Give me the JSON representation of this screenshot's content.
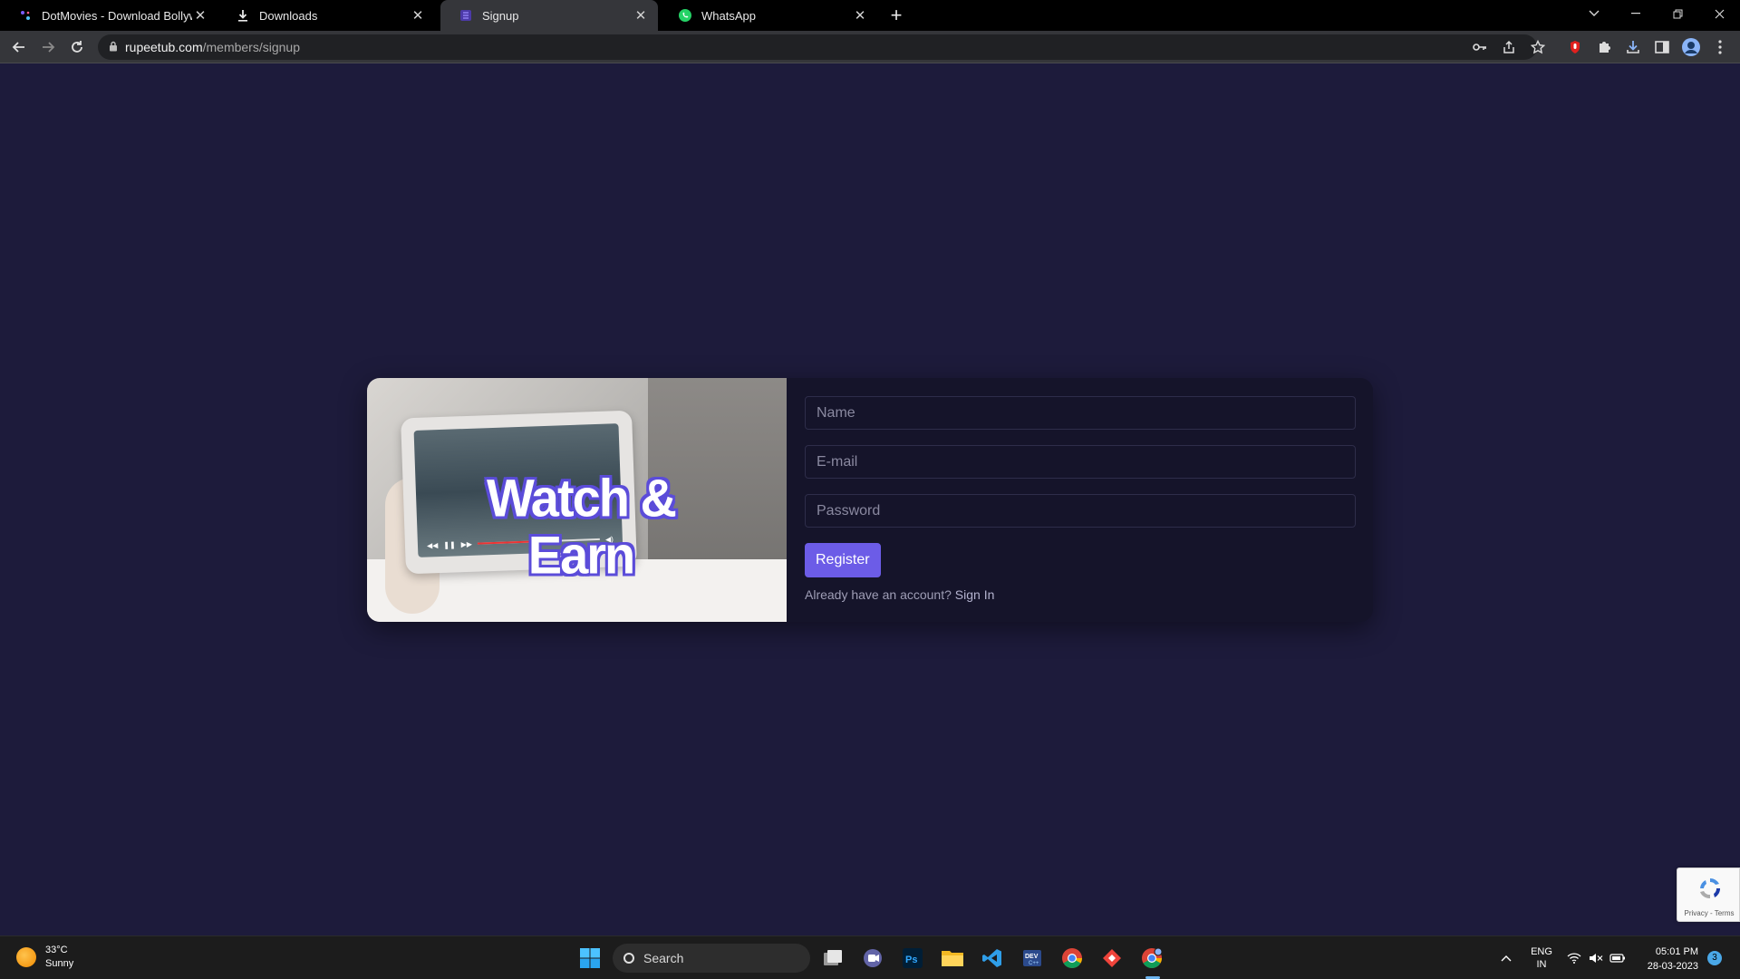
{
  "browser": {
    "tabs": [
      {
        "title": "DotMovies - Download Bollywoo",
        "icon": "dotmovies-icon",
        "active": false
      },
      {
        "title": "Downloads",
        "icon": "download-icon",
        "active": false
      },
      {
        "title": "Signup",
        "icon": "rupeetub-icon",
        "active": true
      },
      {
        "title": "WhatsApp",
        "icon": "whatsapp-icon",
        "active": false
      }
    ],
    "url_host": "rupeetub.com",
    "url_path": "/members/signup"
  },
  "page": {
    "hero_text": "Watch & Earn",
    "form": {
      "name_placeholder": "Name",
      "email_placeholder": "E-mail",
      "password_placeholder": "Password",
      "register_label": "Register",
      "signin_prompt": "Already have an account?",
      "signin_link": "Sign In"
    },
    "recaptcha_terms": "Privacy - Terms"
  },
  "colors": {
    "background": "#1d1b3b",
    "card": "#15142a",
    "accent": "#6c5ce7"
  },
  "taskbar": {
    "weather_temp": "33°C",
    "weather_desc": "Sunny",
    "search_label": "Search",
    "language": "ENG",
    "region": "IN",
    "time": "05:01 PM",
    "date": "28-03-2023",
    "notification_count": "3"
  }
}
